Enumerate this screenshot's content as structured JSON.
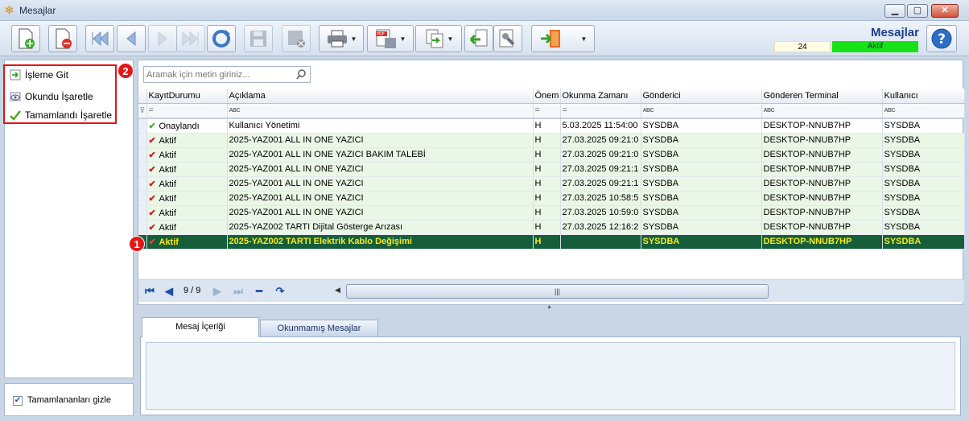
{
  "window": {
    "title": "Mesajlar"
  },
  "header": {
    "title": "Mesajlar",
    "count": "24",
    "status": "Aktif",
    "status_color": "#16e316"
  },
  "left_panel": {
    "items": [
      {
        "label": "İşleme Git",
        "icon": "goto-arrow-icon"
      },
      {
        "label": "Okundu İşaretle",
        "icon": "eye-icon"
      },
      {
        "label": "Tamamlandı İşaretle",
        "icon": "checkmark-icon"
      }
    ],
    "hide_completed_label": "Tamamlananları gizle",
    "hide_completed_checked": true
  },
  "annotations": {
    "badge_1": "1",
    "badge_2": "2",
    "color": "#e21515"
  },
  "search": {
    "placeholder": "Aramak için metin giriniz..."
  },
  "grid": {
    "columns": [
      "KayıtDurumu",
      "Açıklama",
      "Önem",
      "Okunma Zamanı",
      "Gönderici",
      "Gönderen Terminal",
      "Kullanıcı"
    ],
    "filter_row": [
      "=",
      "ABC",
      "=",
      "=",
      "ABC",
      "ABC",
      "ABC"
    ],
    "rows": [
      {
        "status": "Onaylandı",
        "mark": "green",
        "desc": "Kullanıcı Yönetimi",
        "onem": "H",
        "time": "5.03.2025 11:54:00",
        "sender": "SYSDBA",
        "terminal": "DESKTOP-NNUB7HP",
        "user": "SYSDBA"
      },
      {
        "status": "Aktif",
        "mark": "red",
        "desc": "2025-YAZ001 ALL IN ONE YAZICI",
        "onem": "H",
        "time": "27.03.2025 09:21:0",
        "sender": "SYSDBA",
        "terminal": "DESKTOP-NNUB7HP",
        "user": "SYSDBA"
      },
      {
        "status": "Aktif",
        "mark": "red",
        "desc": "2025-YAZ001 ALL IN ONE YAZICI BAKIM TALEBİ",
        "onem": "H",
        "time": "27.03.2025 09:21:0",
        "sender": "SYSDBA",
        "terminal": "DESKTOP-NNUB7HP",
        "user": "SYSDBA"
      },
      {
        "status": "Aktif",
        "mark": "red",
        "desc": "2025-YAZ001 ALL IN ONE YAZICI",
        "onem": "H",
        "time": "27.03.2025 09:21:1",
        "sender": "SYSDBA",
        "terminal": "DESKTOP-NNUB7HP",
        "user": "SYSDBA"
      },
      {
        "status": "Aktif",
        "mark": "red",
        "desc": "2025-YAZ001 ALL IN ONE YAZICI",
        "onem": "H",
        "time": "27.03.2025 09:21:1",
        "sender": "SYSDBA",
        "terminal": "DESKTOP-NNUB7HP",
        "user": "SYSDBA"
      },
      {
        "status": "Aktif",
        "mark": "red",
        "desc": "2025-YAZ001 ALL IN ONE YAZICI",
        "onem": "H",
        "time": "27.03.2025 10:58:5",
        "sender": "SYSDBA",
        "terminal": "DESKTOP-NNUB7HP",
        "user": "SYSDBA"
      },
      {
        "status": "Aktif",
        "mark": "red",
        "desc": "2025-YAZ001 ALL IN ONE YAZICI",
        "onem": "H",
        "time": "27.03.2025 10:59:0",
        "sender": "SYSDBA",
        "terminal": "DESKTOP-NNUB7HP",
        "user": "SYSDBA"
      },
      {
        "status": "Aktif",
        "mark": "red",
        "desc": "2025-YAZ002 TARTI Dijital Gösterge Arızası",
        "onem": "H",
        "time": "27.03.2025 12:16:2",
        "sender": "SYSDBA",
        "terminal": "DESKTOP-NNUB7HP",
        "user": "SYSDBA"
      },
      {
        "status": "Aktif",
        "mark": "red",
        "desc": "2025-YAZ002 TARTI Elektrik Kablo Değişimi",
        "onem": "H",
        "time": "",
        "sender": "SYSDBA",
        "terminal": "DESKTOP-NNUB7HP",
        "user": "SYSDBA",
        "selected": true
      }
    ]
  },
  "navigator": {
    "page": "9 / 9"
  },
  "tabs": [
    {
      "label": "Mesaj İçeriği",
      "active": true
    },
    {
      "label": "Okunmamış Mesajlar",
      "active": false
    }
  ]
}
